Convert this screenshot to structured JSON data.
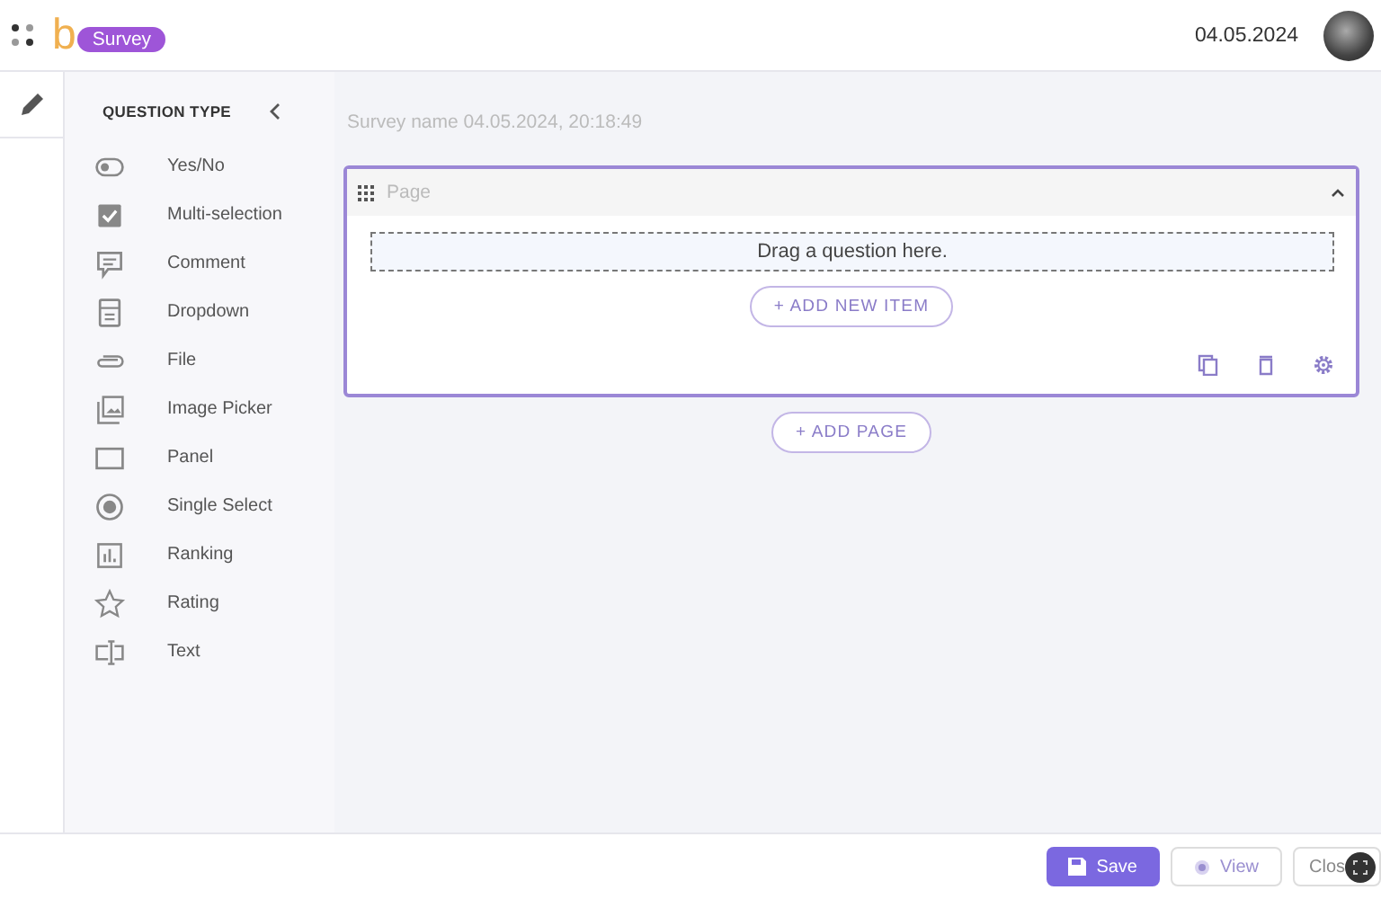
{
  "header": {
    "logo": "b",
    "badge": "Survey",
    "date": "04.05.2024"
  },
  "sidebar": {
    "title": "QUESTION TYPE",
    "items": [
      {
        "label": "Yes/No",
        "kind": "toggle"
      },
      {
        "label": "Multi-selection",
        "kind": "checkbox"
      },
      {
        "label": "Comment",
        "kind": "comment"
      },
      {
        "label": "Dropdown",
        "kind": "dropdown"
      },
      {
        "label": "File",
        "kind": "file"
      },
      {
        "label": "Image Picker",
        "kind": "image"
      },
      {
        "label": "Panel",
        "kind": "panel"
      },
      {
        "label": "Single Select",
        "kind": "radio"
      },
      {
        "label": "Ranking",
        "kind": "ranking"
      },
      {
        "label": "Rating",
        "kind": "rating"
      },
      {
        "label": "Text",
        "kind": "text"
      }
    ]
  },
  "survey": {
    "name": "Survey name 04.05.2024, 20:18:49",
    "page": {
      "title": "Page",
      "expanded": true,
      "drop_hint": "Drag a question here.",
      "add_item": "+ ADD NEW ITEM"
    },
    "add_page": "+ ADD PAGE"
  },
  "footer": {
    "buttons": [
      {
        "label": "Save",
        "kind": "primary"
      },
      {
        "label": "View",
        "kind": "view"
      },
      {
        "label": "Clos",
        "kind": "plain"
      }
    ]
  }
}
